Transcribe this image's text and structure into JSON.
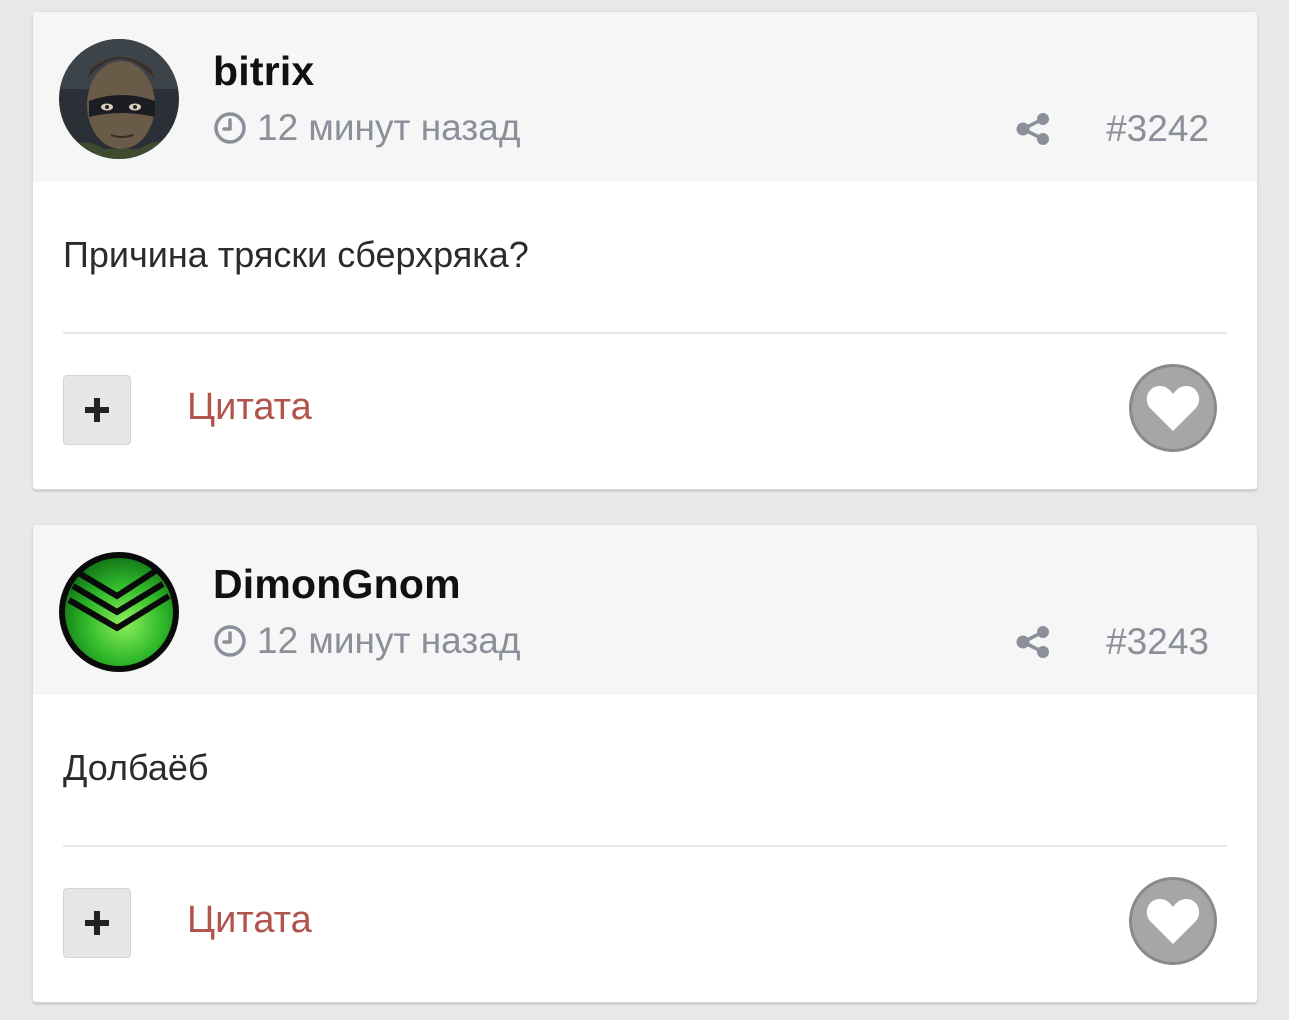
{
  "posts": [
    {
      "author": "bitrix",
      "time": "12 минут назад",
      "post_number": "#3242",
      "text": "Причина тряски сберхряка?",
      "quote_label": "Цитата",
      "avatar": "portrait-avatar"
    },
    {
      "author": "DimonGnom",
      "time": "12 минут назад",
      "post_number": "#3243",
      "text": "Долбаёб",
      "quote_label": "Цитата",
      "avatar": "sberbank-logo-avatar"
    }
  ],
  "colors": {
    "page_bg": "#e8e8e8",
    "header_bg": "#f6f6f6",
    "meta_text": "#8a8f99",
    "quote_link": "#b0544c",
    "like_button": "#a6a6a6"
  },
  "icons": [
    "clock-icon",
    "share-icon",
    "plus-icon",
    "heart-icon"
  ]
}
